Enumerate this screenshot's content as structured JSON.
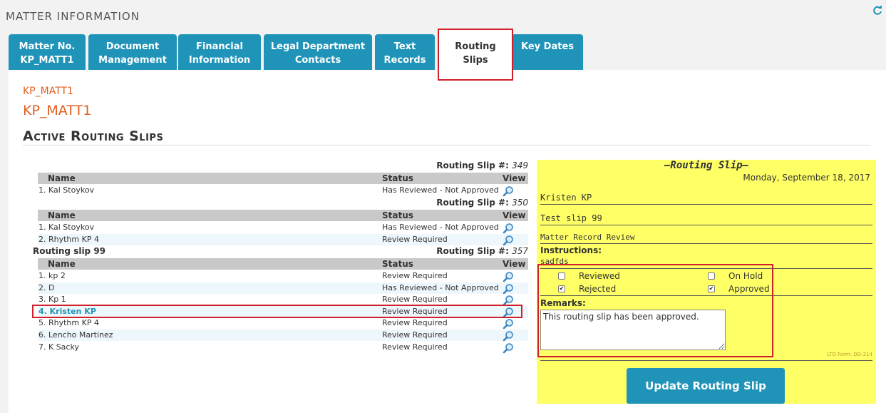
{
  "header": {
    "title": "MATTER INFORMATION",
    "refresh_icon": "refresh-icon"
  },
  "tabs": [
    {
      "label": "Matter No.\nKP_MATT1",
      "active": false
    },
    {
      "label": "Document\nManagement",
      "active": false
    },
    {
      "label": "Financial\nInformation",
      "active": false
    },
    {
      "label": "Legal Department\nContacts",
      "active": false
    },
    {
      "label": "Text\nRecords",
      "active": false
    },
    {
      "label": "Routing\nSlips",
      "active": true
    },
    {
      "label": "Key Dates",
      "active": false
    }
  ],
  "matter": {
    "small": "KP_MATT1",
    "big": "KP_MATT1"
  },
  "section_title": "Active Routing Slips",
  "columns": {
    "name": "Name",
    "status": "Status",
    "view": "View"
  },
  "routing_slip_label": "Routing Slip #:",
  "slips": [
    {
      "number": "349",
      "name": "",
      "rows": [
        {
          "name": "1. Kal Stoykov",
          "status": "Has Reviewed - Not Approved"
        }
      ]
    },
    {
      "number": "350",
      "name": "",
      "rows": [
        {
          "name": "1. Kal Stoykov",
          "status": "Has Reviewed - Not Approved"
        },
        {
          "name": "2. Rhythm KP 4",
          "status": "Review Required"
        }
      ]
    },
    {
      "number": "357",
      "name": "Routing slip 99",
      "rows": [
        {
          "name": "1. kp 2",
          "status": "Review Required"
        },
        {
          "name": "2. D",
          "status": "Has Reviewed - Not Approved"
        },
        {
          "name": "3. Kp 1",
          "status": "Review Required"
        },
        {
          "name": "4. Kristen KP",
          "status": "Review Required",
          "highlight": true
        },
        {
          "name": "5. Rhythm KP 4",
          "status": "Review Required"
        },
        {
          "name": "6. Lencho Martinez",
          "status": "Review Required"
        },
        {
          "name": "7. K Sacky",
          "status": "Review Required"
        }
      ]
    }
  ],
  "panel": {
    "title": "—Routing Slip—",
    "date": "Monday, September 18, 2017",
    "recipient": "Kristen KP",
    "slip_name": "Test slip 99",
    "purpose": "Matter Record Review",
    "instructions_label": "Instructions:",
    "instructions": "sadfds",
    "checkboxes": {
      "reviewed": {
        "label": "Reviewed",
        "checked": false
      },
      "on_hold": {
        "label": "On Hold",
        "checked": false
      },
      "rejected": {
        "label": "Rejected",
        "checked": true
      },
      "approved": {
        "label": "Approved",
        "checked": true
      }
    },
    "remarks_label": "Remarks:",
    "remarks_value": "This routing slip has been approved.",
    "form_id": "LTO Form: DD-214",
    "update_button": "Update Routing Slip"
  },
  "colors": {
    "accent": "#1f94b8",
    "matter": "#e0601f",
    "panel": "#ffff66",
    "highlight_box": "#d0202a"
  }
}
